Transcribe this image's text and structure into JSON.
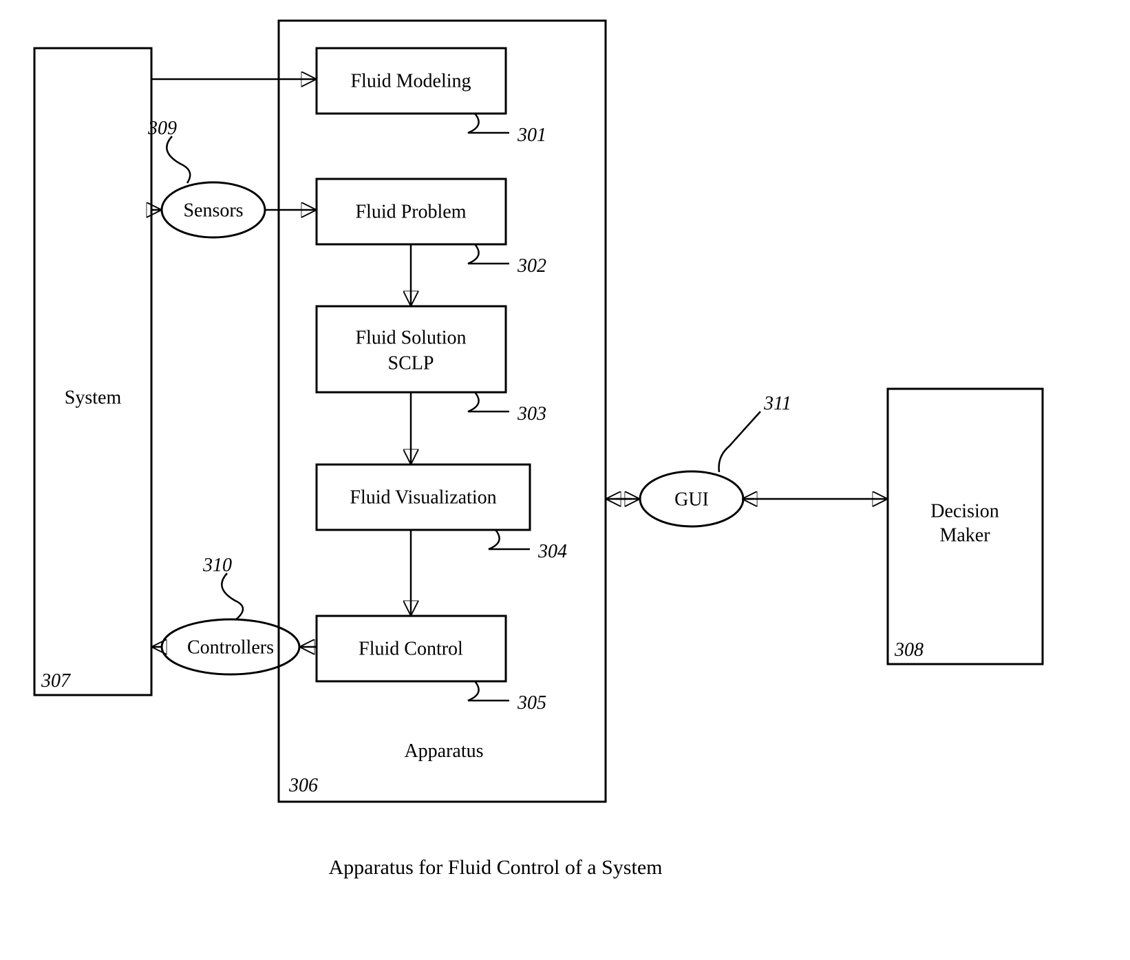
{
  "title": "Apparatus for Fluid Control of a System",
  "blocks": {
    "system": {
      "label": "System",
      "ref": "307"
    },
    "decision": {
      "label1": "Decision",
      "label2": "Maker",
      "ref": "308"
    },
    "apparatus": {
      "label": "Apparatus",
      "ref": "306"
    },
    "modeling": {
      "label": "Fluid Modeling",
      "ref": "301"
    },
    "problem": {
      "label": "Fluid Problem",
      "ref": "302"
    },
    "solution": {
      "label1": "Fluid Solution",
      "label2": "SCLP",
      "ref": "303"
    },
    "visual": {
      "label": "Fluid Visualization",
      "ref": "304"
    },
    "control": {
      "label": "Fluid Control",
      "ref": "305"
    }
  },
  "ellipses": {
    "sensors": {
      "label": "Sensors",
      "ref": "309"
    },
    "controllers": {
      "label": "Controllers",
      "ref": "310"
    },
    "gui": {
      "label": "GUI",
      "ref": "311"
    }
  }
}
